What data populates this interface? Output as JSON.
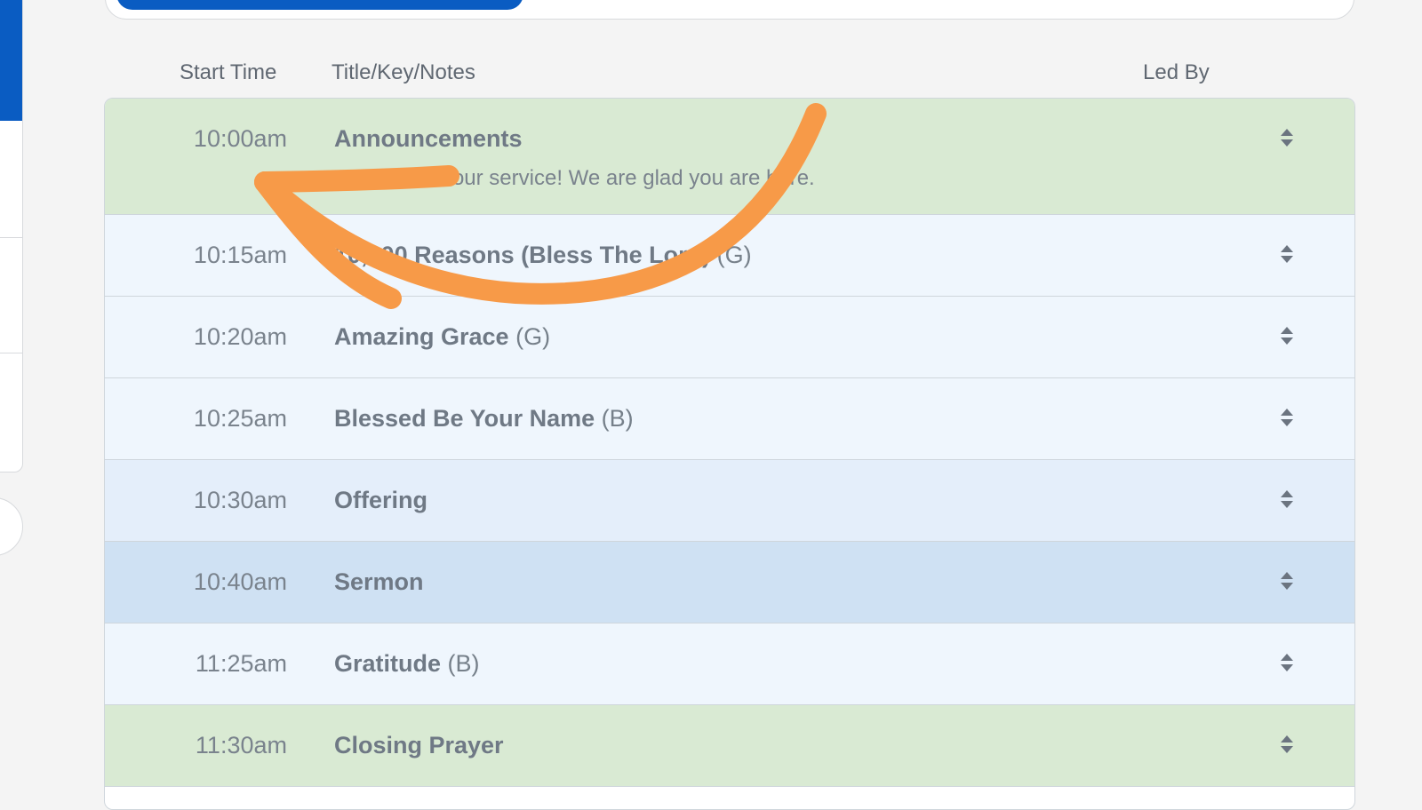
{
  "columns": {
    "start_time": "Start Time",
    "title": "Title/Key/Notes",
    "led_by": "Led By"
  },
  "rows": [
    {
      "time": "10:00am",
      "title": "Announcements",
      "key": "",
      "note": "Welcome to our service! We are glad you are here.",
      "color": "#d9ead3"
    },
    {
      "time": "10:15am",
      "title": "10,000 Reasons (Bless The Lord)",
      "key": "(G)",
      "note": "",
      "color": "#eff6fd"
    },
    {
      "time": "10:20am",
      "title": "Amazing Grace",
      "key": "(G)",
      "note": "",
      "color": "#eff6fd"
    },
    {
      "time": "10:25am",
      "title": "Blessed Be Your Name",
      "key": "(B)",
      "note": "",
      "color": "#eff6fd"
    },
    {
      "time": "10:30am",
      "title": "Offering",
      "key": "",
      "note": "",
      "color": "#e4eefa"
    },
    {
      "time": "10:40am",
      "title": "Sermon",
      "key": "",
      "note": "",
      "color": "#cfe1f3"
    },
    {
      "time": "11:25am",
      "title": "Gratitude",
      "key": "(B)",
      "note": "",
      "color": "#eff6fd"
    },
    {
      "time": "11:30am",
      "title": "Closing Prayer",
      "key": "",
      "note": "",
      "color": "#d9ead3"
    }
  ],
  "icons": {
    "sort": "sort-handle-icon",
    "annotation": "curved-arrow-annotation"
  },
  "colors": {
    "brand_blue": "#0a5cc2",
    "annotation_orange": "#f79a48"
  }
}
